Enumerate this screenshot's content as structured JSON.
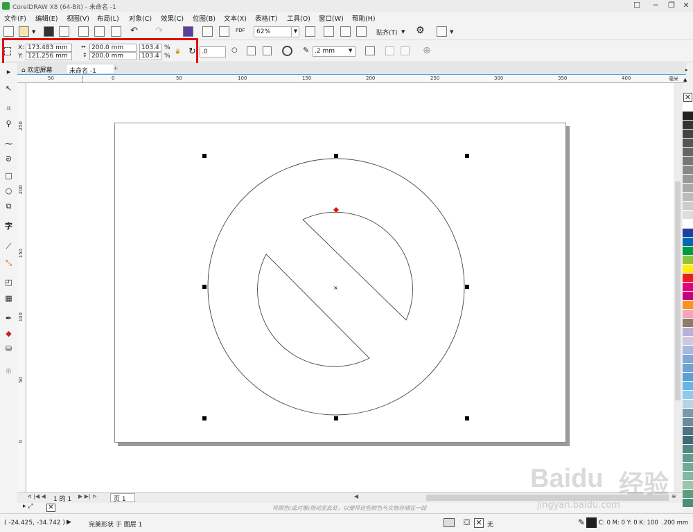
{
  "window": {
    "title": "CorelDRAW X8 (64-Bit) - 未命名 -1"
  },
  "menu": [
    "文件(F)",
    "编辑(E)",
    "视图(V)",
    "布局(L)",
    "对象(C)",
    "效果(C)",
    "位图(B)",
    "文本(X)",
    "表格(T)",
    "工具(O)",
    "窗口(W)",
    "帮助(H)"
  ],
  "toolbar": {
    "zoom": "62%",
    "pdf_label": "PDF",
    "snap_label": "贴齐(T)"
  },
  "propbar": {
    "x_label": "X:",
    "x_value": "173.483 mm",
    "y_label": "Y:",
    "y_value": "121.256 mm",
    "width_value": "200.0 mm",
    "height_value": "200.0 mm",
    "scale_x": "103.4",
    "scale_y": "103.4",
    "pct1": "%",
    "pct2": "%",
    "rotation": ".0",
    "outline_width": ".2 mm"
  },
  "tabs": {
    "welcome": "欢迎屏幕",
    "doc": "未命名 -1",
    "add": "+"
  },
  "ruler_top": [
    "50",
    "0",
    "50",
    "100",
    "150",
    "200",
    "250",
    "300",
    "350",
    "400"
  ],
  "ruler_unit": "毫米",
  "ruler_left": [
    "250",
    "200",
    "150",
    "100",
    "50",
    "0"
  ],
  "doc_nav": {
    "page_count": "1 的 1",
    "page_tab": "页 1"
  },
  "hint": "将颜色(或对象)拖动至此处，以便将这些颜色与文档存储在一起",
  "status": {
    "coords": "( -24.425, -34.742 )",
    "layer_info": "完美形状 于 图层 1",
    "fill_none": "无",
    "outline_color": "C: 0 M: 0 Y: 0 K: 100",
    "outline_width": ".200 mm"
  },
  "watermark": {
    "brand": "Baidu",
    "brand_cn": "经验",
    "url": "jingyan.baidu.com"
  },
  "palette": [
    "#ffffff",
    "#231f20",
    "#333333",
    "#444444",
    "#555555",
    "#666666",
    "#777777",
    "#888888",
    "#999999",
    "#aaaaaa",
    "#bbbbbb",
    "#cccccc",
    "#dddddd",
    "#ffffff",
    "#1e3ea0",
    "#0069b4",
    "#009a44",
    "#8dc63f",
    "#fff200",
    "#ed1c24",
    "#e2007a",
    "#c5007c",
    "#f7941d",
    "#f4a6b8",
    "#8b7d6b",
    "#b5b1d8",
    "#d0c7e2",
    "#a5b9dd",
    "#7ea8d8",
    "#6fa2cf",
    "#5aa0d8",
    "#64b5e8",
    "#8ec9ee",
    "#b5d4e6",
    "#7a9aa8",
    "#6a8d9b",
    "#4e7384",
    "#3d6b77",
    "#4f8a80",
    "#5f9d8e",
    "#71ab97",
    "#85b8a0",
    "#9cc5a9",
    "#5e9b85",
    "#4c8e78"
  ]
}
